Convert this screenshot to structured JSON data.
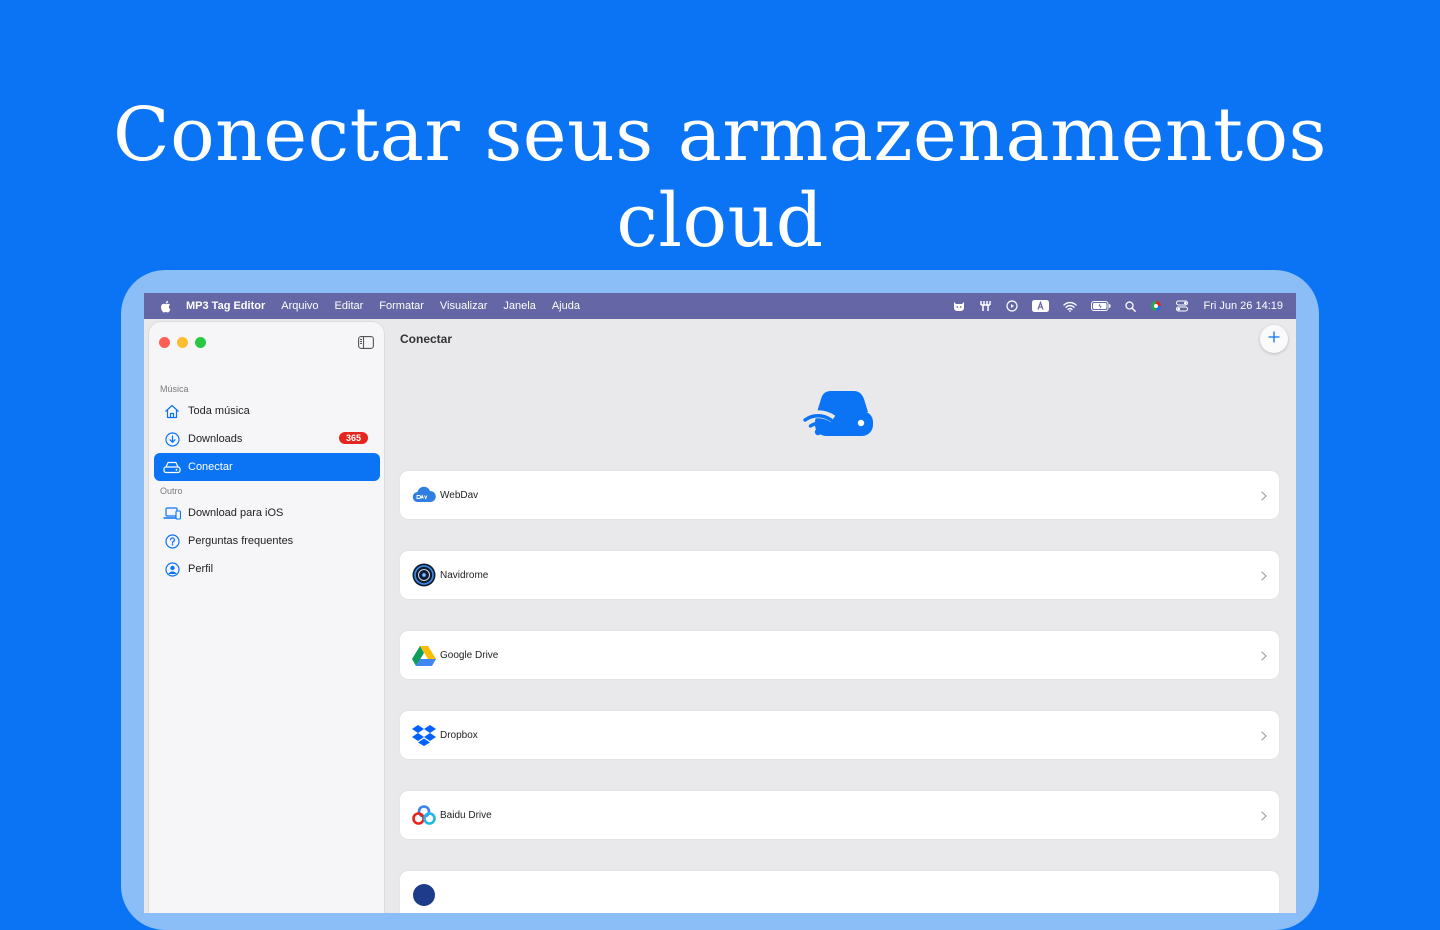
{
  "headline": "Conectar seus armazenamentos cloud",
  "menubar": {
    "app_name": "MP3 Tag Editor",
    "menus": [
      "Arquivo",
      "Editar",
      "Formatar",
      "Visualizar",
      "Janela",
      "Ajuda"
    ],
    "clock": "Fri Jun 26  14:19",
    "status_icons": [
      "cat-icon",
      "fork-icon",
      "play-circle-icon",
      "keyboard-a-icon",
      "wifi-icon",
      "battery-icon",
      "search-icon",
      "color-circle-icon",
      "control-center-icon"
    ]
  },
  "sidebar": {
    "section_music": "Música",
    "section_other": "Outro",
    "items": [
      {
        "label": "Toda música",
        "icon": "house-icon"
      },
      {
        "label": "Downloads",
        "icon": "download-circle-icon",
        "badge": "365"
      },
      {
        "label": "Conectar",
        "icon": "network-drive-icon",
        "active": true
      },
      {
        "label": "Download para iOS",
        "icon": "laptop-phone-icon"
      },
      {
        "label": "Perguntas frequentes",
        "icon": "question-circle-icon"
      },
      {
        "label": "Perfil",
        "icon": "person-circle-icon"
      }
    ]
  },
  "content": {
    "title": "Conectar",
    "services": [
      {
        "label": "WebDav",
        "icon": "webdav-icon"
      },
      {
        "label": "Navidrome",
        "icon": "navidrome-icon"
      },
      {
        "label": "Google Drive",
        "icon": "google-drive-icon"
      },
      {
        "label": "Dropbox",
        "icon": "dropbox-icon"
      },
      {
        "label": "Baidu Drive",
        "icon": "baidu-drive-icon"
      }
    ]
  },
  "colors": {
    "accent": "#0a74f5",
    "badge": "#e5261d",
    "menubar": "#6466a6"
  }
}
